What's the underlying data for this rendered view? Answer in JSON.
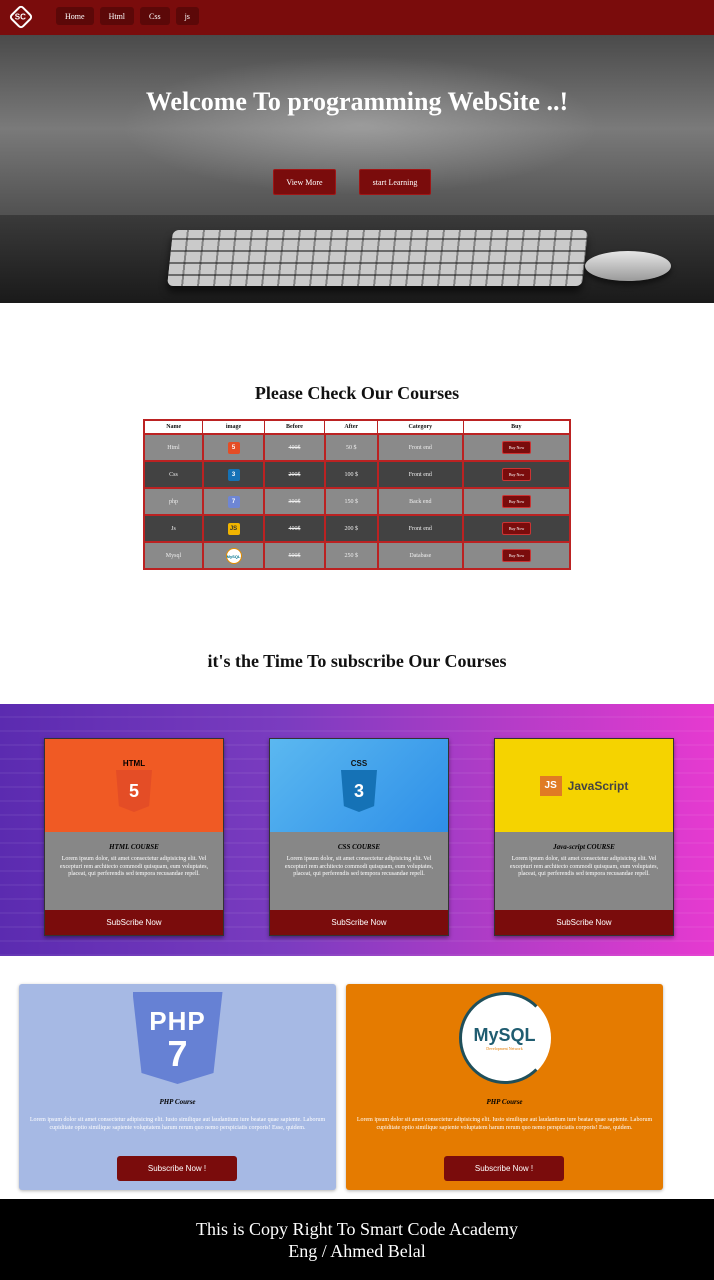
{
  "nav": {
    "logo_text": "SC",
    "links": [
      "Home",
      "Html",
      "Css",
      "js"
    ]
  },
  "hero": {
    "title": "Welcome To programming WebSite ..!",
    "view_more": "View More",
    "start_learning": "start Learning"
  },
  "courses": {
    "title": "Please Check Our Courses",
    "headers": [
      "Name",
      "image",
      "Before",
      "After",
      "Category",
      "Buy"
    ],
    "rows": [
      {
        "name": "Html",
        "icon": "html5-icon",
        "icon_text": "5",
        "before": "400$",
        "after": "50 $",
        "category": "Front end",
        "buy": "Buy Now"
      },
      {
        "name": "Css",
        "icon": "css3-icon",
        "icon_text": "3",
        "before": "200$",
        "after": "100 $",
        "category": "Front end",
        "buy": "Buy Now"
      },
      {
        "name": "php",
        "icon": "php7-icon",
        "icon_text": "7",
        "before": "300$",
        "after": "150 $",
        "category": "Back end",
        "buy": "Buy Now"
      },
      {
        "name": "Js",
        "icon": "js-icon",
        "icon_text": "JS",
        "before": "400$",
        "after": "200 $",
        "category": "Front end",
        "buy": "Buy Now"
      },
      {
        "name": "Mysql",
        "icon": "mysql-icon",
        "icon_text": "MySQL",
        "before": "500$",
        "after": "250 $",
        "category": "Database",
        "buy": "Buy Now"
      }
    ]
  },
  "subscribe": {
    "title": "it's the Time To subscribe Our Courses",
    "cards": [
      {
        "logo_label": "HTML",
        "logo_glyph": "5",
        "title": "HTML COURSE",
        "text": "Lorem ipsum dolor, sit amet consectetur adipisicing elit. Vel excepturi rem architecto commodi quisquam, eum voluptates, placeat, qui perferendis sed tempora recusandae repell.",
        "button": "SubScribe Now"
      },
      {
        "logo_label": "CSS",
        "logo_glyph": "3",
        "title": "CSS COURSE",
        "text": "Lorem ipsum dolor, sit amet consectetur adipisicing elit. Vel excepturi rem architecto commodi quisquam, eum voluptates, placeat, qui perferendis sed tempora recusandae repell.",
        "button": "SubScribe Now"
      },
      {
        "logo_label": "JS",
        "logo_glyph": "JavaScript",
        "title": "Java-script COURSE",
        "text": "Lorem ipsum dolor, sit amet consectetur adipisicing elit. Vel excepturi rem architecto commodi quisquam, eum voluptates, placeat, qui perferendis sed tempora recusandae repell.",
        "button": "SubScribe Now"
      }
    ]
  },
  "big_cards": [
    {
      "logo_line1": "PHP",
      "logo_line2": "7",
      "title": "PHP Course",
      "text": "Lorem ipsum dolor sit amet consectetur adipisicing elit. Iusto similique aut laudantium iure beatae quae sapiente. Laborum cupiditate optio similique sapiente voluptatem harum rerum quo nemo perspiciatis corporis! Esse, quidem.",
      "button": "Subscribe Now !"
    },
    {
      "logo_line1": "MySQL",
      "logo_line2": "Development Network",
      "title": "PHP Course",
      "text": "Lorem ipsum dolor sit amet consectetur adipisicing elit. Iusto similique aut laudantium iure beatae quae sapiente. Laborum cupiditate optio similique sapiente voluptatem harum rerum quo nemo perspiciatis corporis! Esse, quidem.",
      "button": "Subscribe Now !"
    }
  ],
  "footer": {
    "line1": "This is Copy Right To Smart Code Academy",
    "line2": "Eng / Ahmed Belal"
  }
}
